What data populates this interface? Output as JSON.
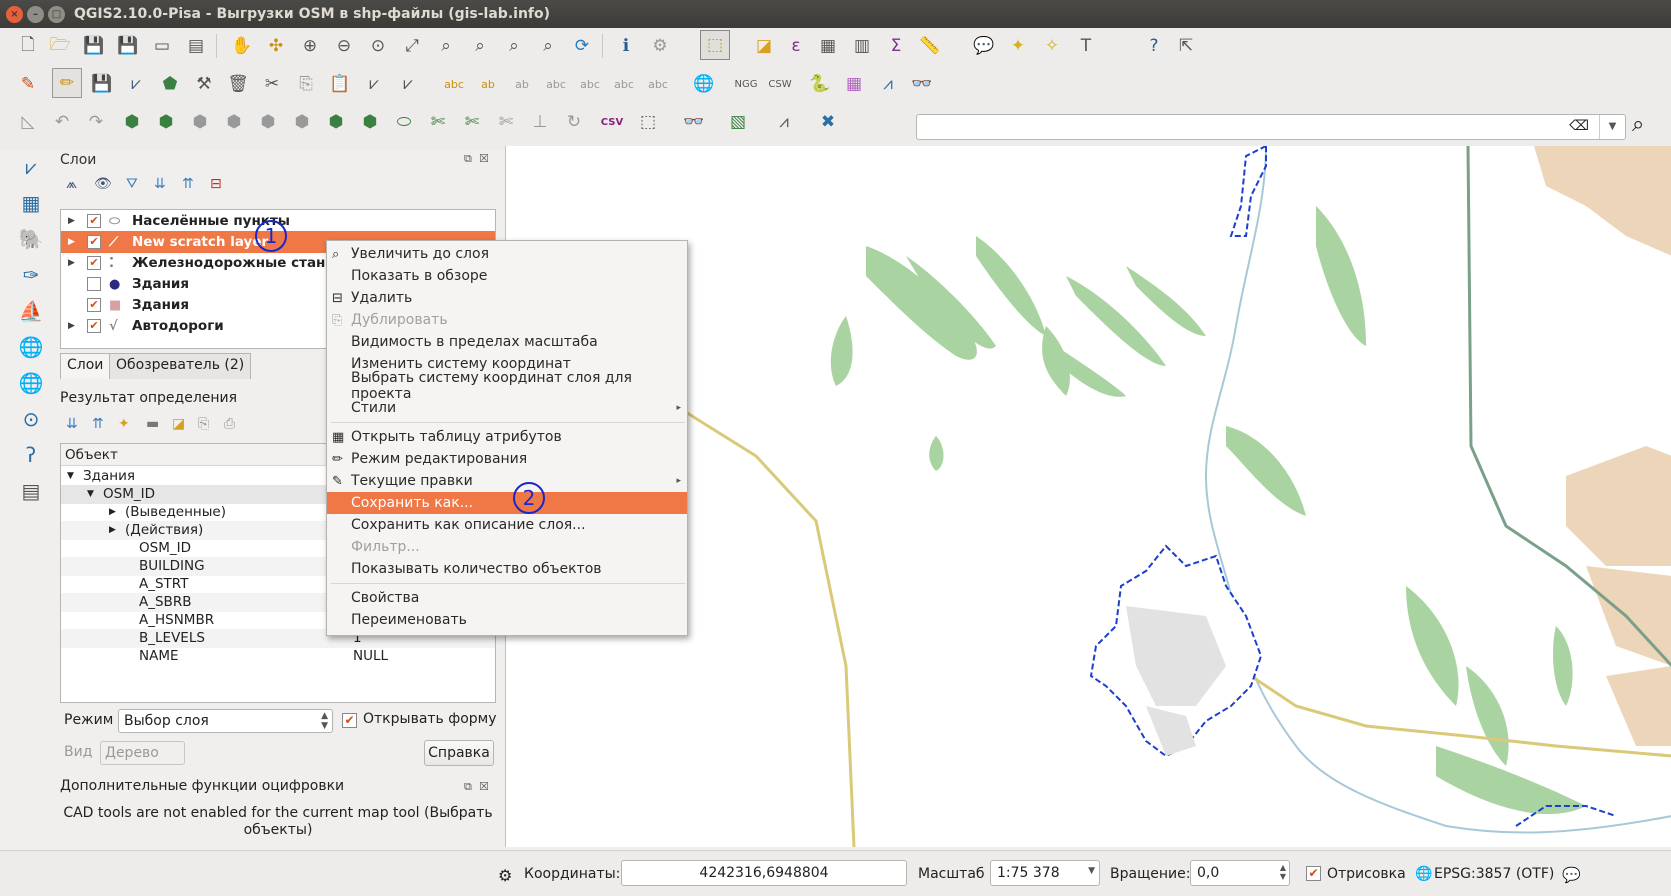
{
  "window": {
    "title": "QGIS2.10.0-Pisa - Выгрузки OSM в shp-файлы (gis-lab.info)"
  },
  "layers_panel": {
    "title": "Слои",
    "items": [
      {
        "label": "Населённые пункты",
        "checked": true,
        "selected": false
      },
      {
        "label": "New scratch layer",
        "checked": true,
        "selected": true
      },
      {
        "label": "Железнодорожные станции",
        "checked": true,
        "selected": false
      },
      {
        "label": "Здания",
        "checked": false,
        "selected": false
      },
      {
        "label": "Здания",
        "checked": true,
        "selected": false
      },
      {
        "label": "Автодороги",
        "checked": true,
        "selected": false
      }
    ],
    "tabs": [
      "Слои",
      "Обозреватель (2)"
    ]
  },
  "markers": [
    "1",
    "2"
  ],
  "identify": {
    "title": "Результат определения",
    "header": "Объект",
    "rows": [
      {
        "key": "Здания",
        "value": "",
        "indent": 1
      },
      {
        "key": "OSM_ID",
        "value": "",
        "indent": 2
      },
      {
        "key": "(Выведенные)",
        "value": "",
        "indent": 3
      },
      {
        "key": "(Действия)",
        "value": "",
        "indent": 3
      },
      {
        "key": "OSM_ID",
        "value": "",
        "indent": 4
      },
      {
        "key": "BUILDING",
        "value": "",
        "indent": 4
      },
      {
        "key": "A_STRT",
        "value": "",
        "indent": 4
      },
      {
        "key": "A_SBRB",
        "value": "",
        "indent": 4
      },
      {
        "key": "A_HSNMBR",
        "value": "",
        "indent": 4
      },
      {
        "key": "B_LEVELS",
        "value": "1",
        "indent": 4
      },
      {
        "key": "NAME",
        "value": "NULL",
        "indent": 4
      }
    ],
    "mode_label": "Режим",
    "mode_value": "Выбор слоя",
    "open_form_label": "Открывать форму",
    "view_label": "Вид",
    "view_value": "Дерево",
    "help_label": "Справка"
  },
  "cad": {
    "title": "Дополнительные функции оцифровки",
    "message": "CAD tools are not enabled for the current map tool (Выбрать объекты)"
  },
  "context_menu": {
    "items": [
      {
        "label": "Увеличить до слоя",
        "icon": "zoom-icon"
      },
      {
        "label": "Показать в обзоре"
      },
      {
        "label": "Удалить",
        "icon": "remove-icon"
      },
      {
        "label": "Дублировать",
        "disabled": true,
        "icon": "duplicate-icon"
      },
      {
        "label": "Видимость в пределах масштаба"
      },
      {
        "label": "Изменить систему координат"
      },
      {
        "label": "Выбрать систему координат слоя для проекта"
      },
      {
        "label": "Стили",
        "submenu": true
      },
      {
        "label": "Открыть таблицу атрибутов",
        "icon": "table-icon"
      },
      {
        "label": "Режим редактирования",
        "icon": "pencil-icon"
      },
      {
        "label": "Текущие правки",
        "submenu": true,
        "icon": "edits-icon"
      },
      {
        "label": "Сохранить как...",
        "highlighted": true
      },
      {
        "label": "Сохранить как описание слоя..."
      },
      {
        "label": "Фильтр...",
        "disabled": true
      },
      {
        "label": "Показывать количество объектов"
      },
      {
        "label": "Свойства"
      },
      {
        "label": "Переименовать"
      }
    ]
  },
  "statusbar": {
    "coords_label": "Координаты:",
    "coords_value": "4242316,6948804",
    "scale_label": "Масштаб",
    "scale_value": "1:75 378",
    "rotation_label": "Вращение:",
    "rotation_value": "0,0",
    "render_label": "Отрисовка",
    "crs_label": "EPSG:3857 (OTF)"
  },
  "colors": {
    "accent": "#f07746",
    "marker": "#1a28c8",
    "forest": "#a9d3a0",
    "urban": "#ecd5b8",
    "water": "#a7c8d8",
    "boundary": "#1c3fd0"
  }
}
